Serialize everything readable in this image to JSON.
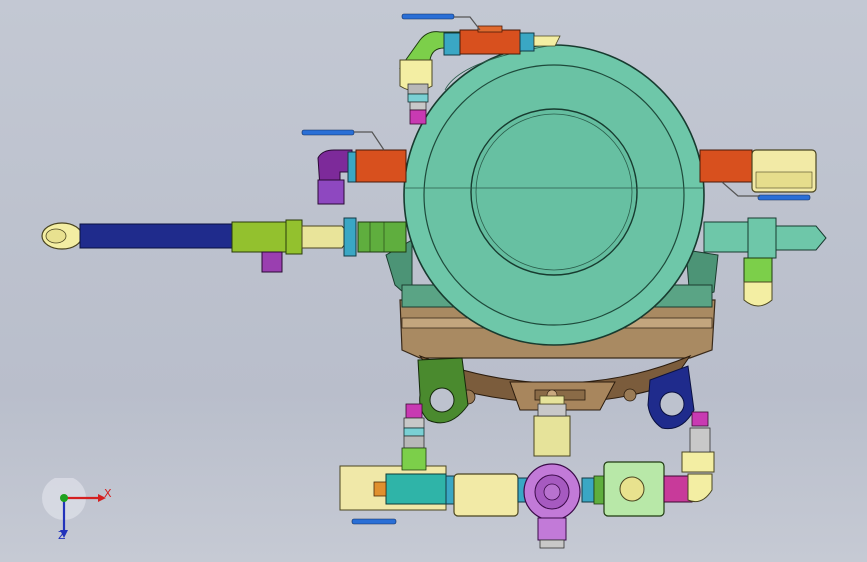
{
  "viewport": {
    "background_top": "#c3c8d3",
    "background_bottom": "#c6cad4"
  },
  "triad": {
    "x_label": "X",
    "z_label": "Z",
    "x_color": "#d42020",
    "y_color": "#1fa21f",
    "z_color": "#2233bb"
  },
  "colors": {
    "drum": "#6cc6a8",
    "drum_dark": "#4fa48a",
    "valve_red": "#d84a1c",
    "pipe_blue": "#1e2a8a",
    "fitting_cyan": "#4bb8c8",
    "fitting_yellow": "#f2eea0",
    "fitting_green": "#8fbf2e",
    "fitting_purple": "#9a3fb0",
    "base_brown": "#8c6d4a",
    "magenta": "#c83a9a"
  }
}
